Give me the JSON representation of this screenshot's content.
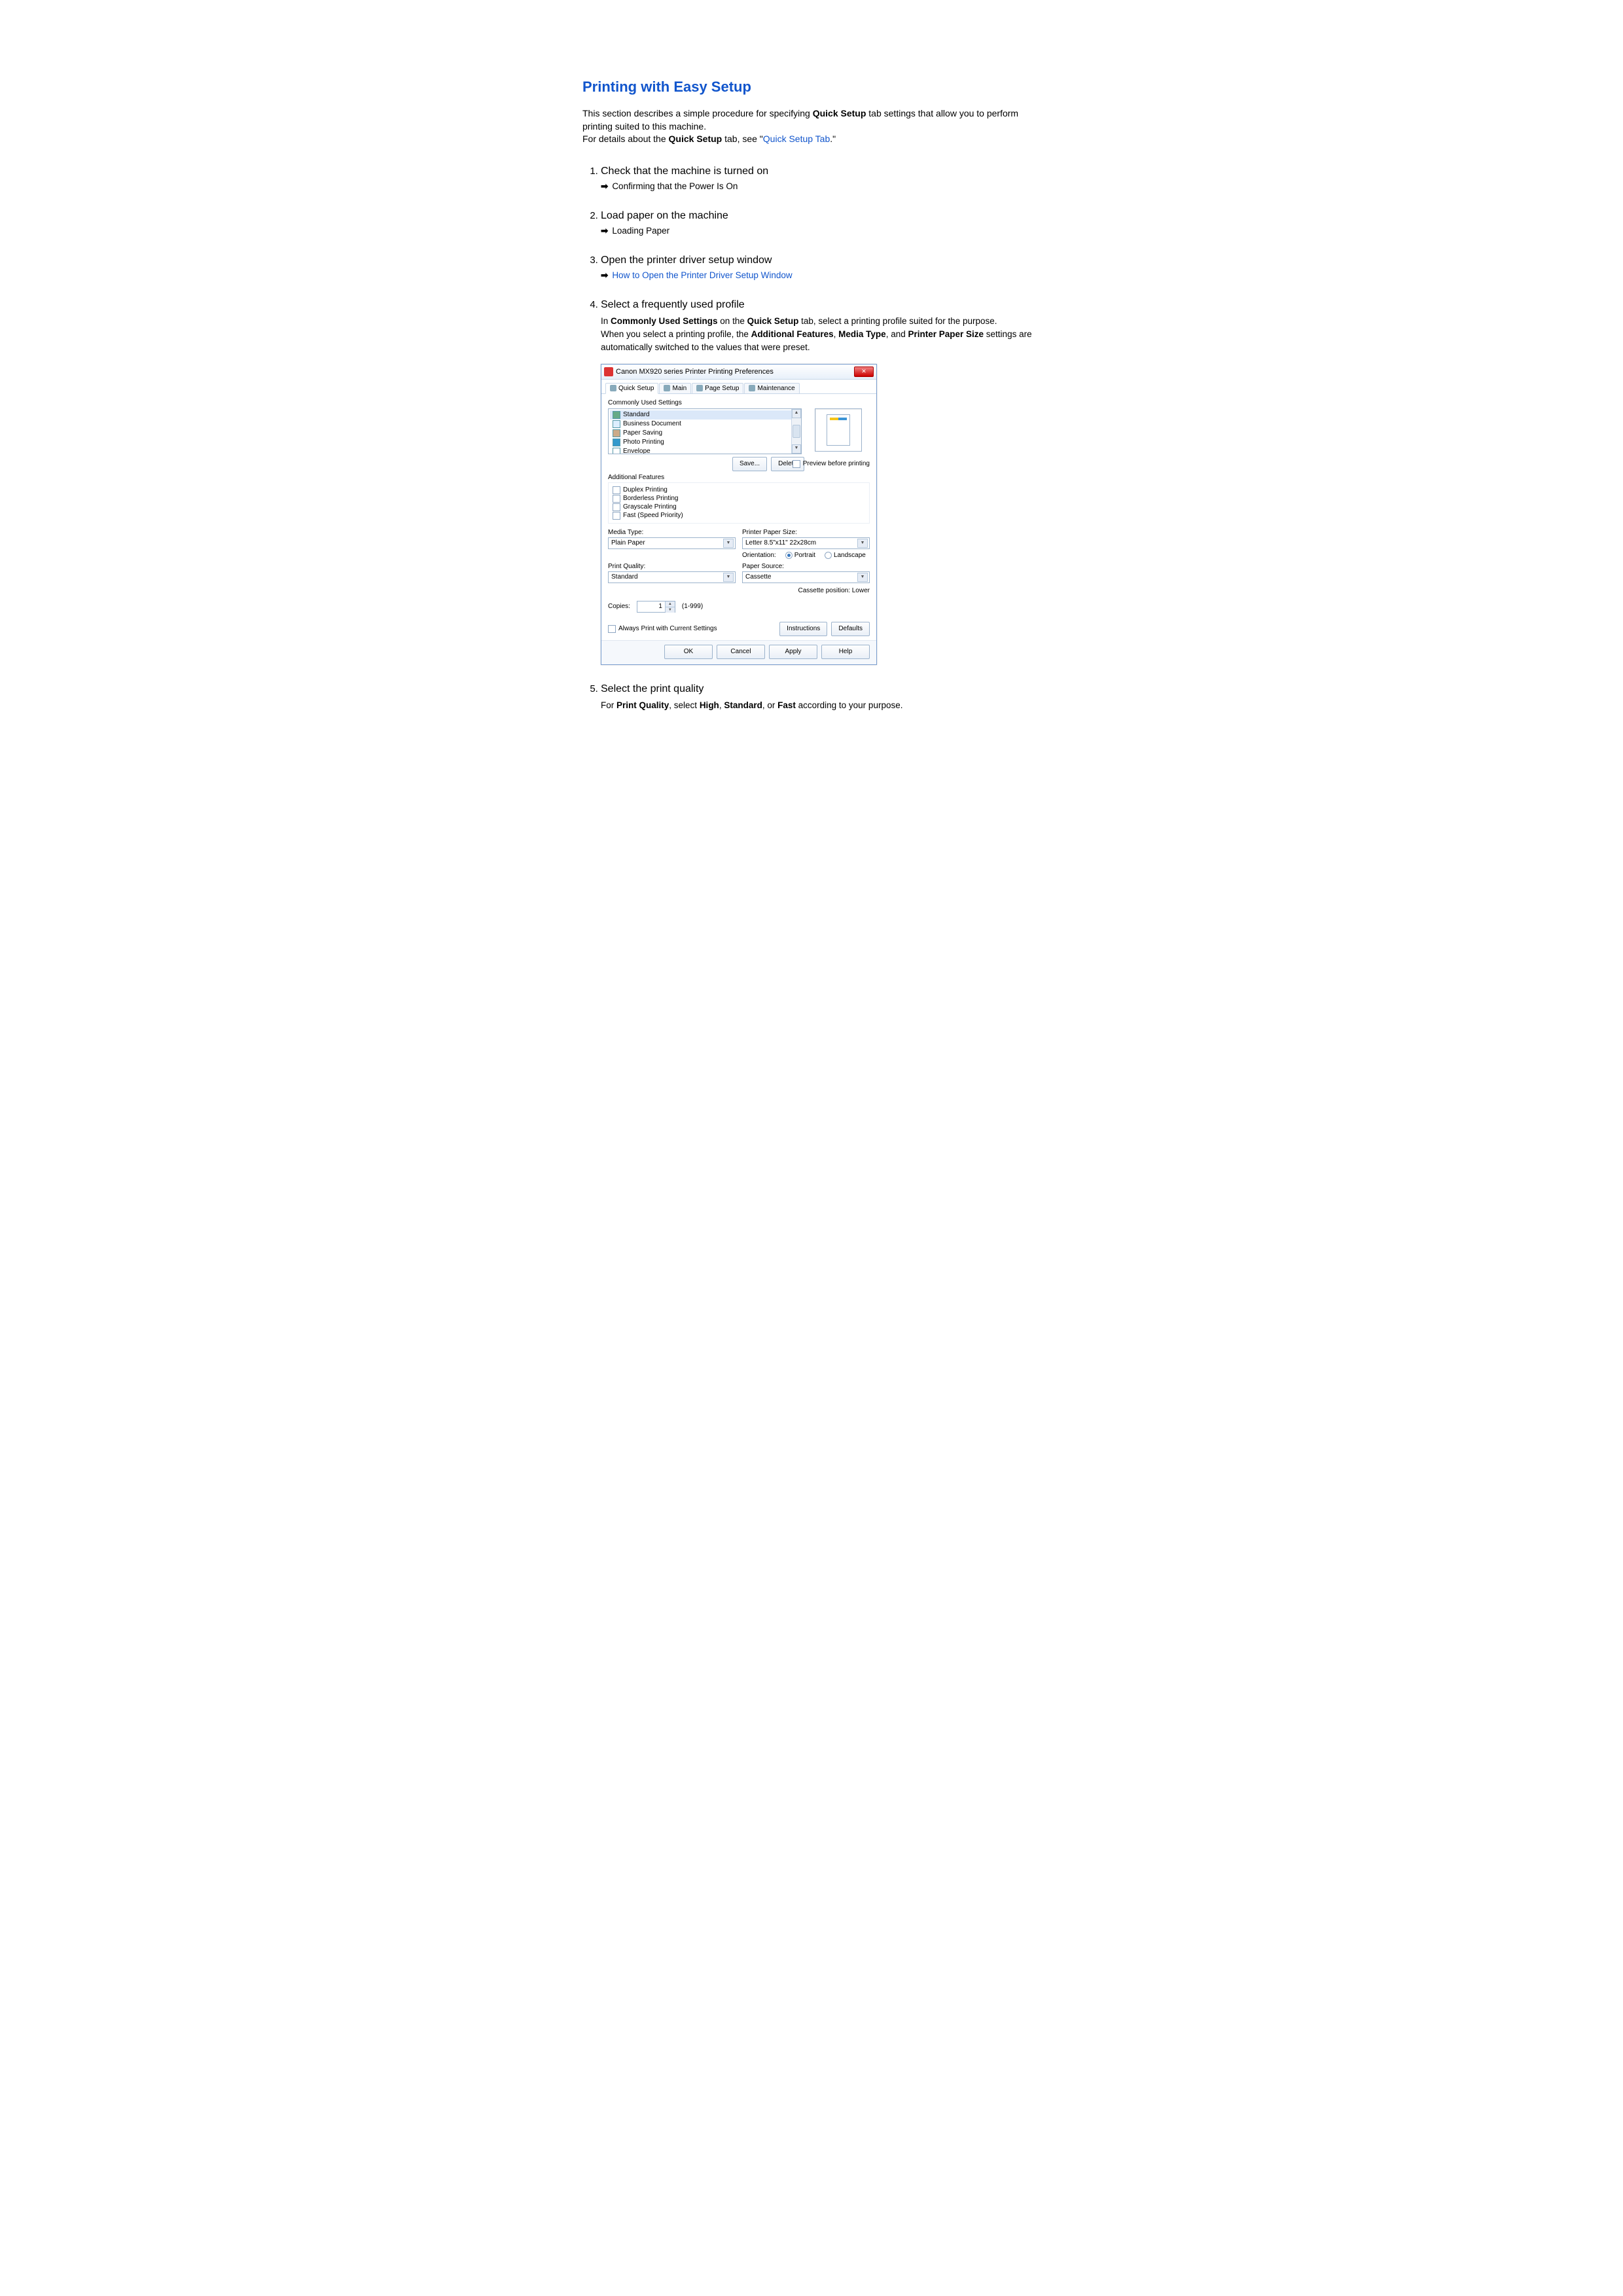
{
  "title": "Printing with Easy Setup",
  "intro": {
    "line1a": "This section describes a simple procedure for specifying ",
    "line1b": "Quick Setup",
    "line1c": " tab settings that allow you to perform printing suited to this machine.",
    "line2a": "For details about the ",
    "line2b": "Quick Setup",
    "line2c": " tab, see \"",
    "link": "Quick Setup Tab",
    "line2d": ".\""
  },
  "steps": {
    "s1": {
      "head": "Check that the machine is turned on",
      "sub": "Confirming that the Power Is On"
    },
    "s2": {
      "head": "Load paper on the machine",
      "sub": "Loading Paper"
    },
    "s3": {
      "head": "Open the printer driver setup window",
      "sub": "How to Open the Printer Driver Setup Window"
    },
    "s4": {
      "head": "Select a frequently used profile",
      "p_a": "In ",
      "p_b": "Commonly Used Settings",
      "p_c": " on the ",
      "p_d": "Quick Setup",
      "p_e": " tab, select a printing profile suited for the purpose.",
      "p_f": "When you select a printing profile, the ",
      "p_g": "Additional Features",
      "p_h": ", ",
      "p_i": "Media Type",
      "p_j": ", and ",
      "p_k": "Printer Paper Size",
      "p_l": " settings are automatically switched to the values that were preset."
    },
    "s5": {
      "head": "Select the print quality",
      "p_a": "For ",
      "p_b": "Print Quality",
      "p_c": ", select ",
      "p_d": "High",
      "p_e": ", ",
      "p_f": "Standard",
      "p_g": ", or ",
      "p_h": "Fast",
      "p_i": " according to your purpose."
    }
  },
  "dialog": {
    "title": "Canon MX920 series Printer Printing Preferences",
    "tabs": {
      "quick": "Quick Setup",
      "main": "Main",
      "page": "Page Setup",
      "maint": "Maintenance"
    },
    "commonly_used": "Commonly Used Settings",
    "profiles": {
      "p0": "Standard",
      "p1": "Business Document",
      "p2": "Paper Saving",
      "p3": "Photo Printing",
      "p4": "Envelope"
    },
    "save": "Save...",
    "delete": "Delete",
    "preview_before": "Preview before printing",
    "additional_features": "Additional Features",
    "feat": {
      "f0": "Duplex Printing",
      "f1": "Borderless Printing",
      "f2": "Grayscale Printing",
      "f3": "Fast (Speed Priority)"
    },
    "media_type_lbl": "Media Type:",
    "media_type_val": "Plain Paper",
    "paper_size_lbl": "Printer Paper Size:",
    "paper_size_val": "Letter 8.5\"x11\" 22x28cm",
    "orientation_lbl": "Orientation:",
    "portrait": "Portrait",
    "landscape": "Landscape",
    "print_quality_lbl": "Print Quality:",
    "print_quality_val": "Standard",
    "paper_source_lbl": "Paper Source:",
    "paper_source_val": "Cassette",
    "cassette_pos": "Cassette position: Lower",
    "copies_lbl": "Copies:",
    "copies_val": "1",
    "copies_range": "(1-999)",
    "always_print": "Always Print with Current Settings",
    "instructions": "Instructions",
    "defaults": "Defaults",
    "ok": "OK",
    "cancel": "Cancel",
    "apply": "Apply",
    "help": "Help"
  }
}
